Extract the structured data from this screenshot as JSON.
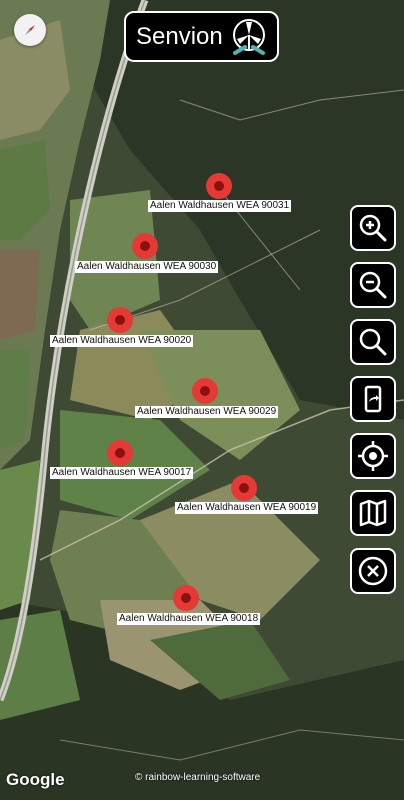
{
  "app": {
    "title": "Senvion"
  },
  "markers": [
    {
      "label": "Aalen Waldhausen WEA 90031"
    },
    {
      "label": "Aalen Waldhausen WEA 90030"
    },
    {
      "label": "Aalen Waldhausen WEA 90020"
    },
    {
      "label": "Aalen Waldhausen WEA 90029"
    },
    {
      "label": "Aalen Waldhausen WEA 90017"
    },
    {
      "label": "Aalen Waldhausen WEA 90019"
    },
    {
      "label": "Aalen Waldhausen WEA 90018"
    }
  ],
  "controls": [
    {
      "name": "zoom-in",
      "icon": "zoom-in-icon"
    },
    {
      "name": "zoom-out",
      "icon": "zoom-out-icon"
    },
    {
      "name": "search",
      "icon": "search-icon"
    },
    {
      "name": "share",
      "icon": "share-phone-icon"
    },
    {
      "name": "locate",
      "icon": "location-target-icon"
    },
    {
      "name": "map-type",
      "icon": "map-icon"
    },
    {
      "name": "close",
      "icon": "close-icon"
    }
  ],
  "footer": {
    "google": "Google",
    "copyright": "© rainbow-learning-software"
  },
  "colors": {
    "marker": "#e53935",
    "control_bg": "#000000",
    "accent_teal": "#4fb3b3"
  }
}
